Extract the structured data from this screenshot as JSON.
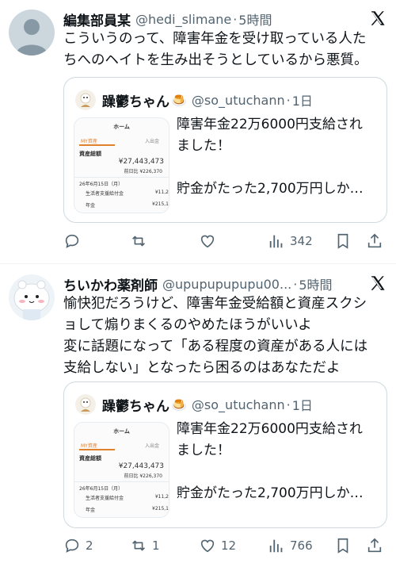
{
  "posts": [
    {
      "author_name": "編集部員某",
      "handle": "@hedi_slimane",
      "separator": "·",
      "time": "5時間",
      "lines": [
        "こういうのって、障害年金を受け取っている人た",
        "ちへのヘイトを生み出そうとしているから悪質。"
      ],
      "quote": {
        "name": "躁鬱ちゃん",
        "emoji": "🍮",
        "handle": "@so_utuchann",
        "separator": "·",
        "time": "1日",
        "lines": [
          "障害年金22万6000円支給され",
          "ました！",
          "",
          "貯金がたった2,700万円しか…"
        ],
        "thumb": {
          "tab_home": "ホーム",
          "tab_left": "MY資産",
          "tab_right": "入出金",
          "label": "資産総額",
          "total": "¥27,443,473",
          "diff": "前日比 ¥226,370",
          "date": "26年6月15日（月）",
          "row1": "生活者支援給付金",
          "row1_value": "¥11,2",
          "row2": "年金",
          "row2_value": "¥215,1"
        }
      },
      "actions": {
        "replies": "",
        "reposts": "",
        "likes": "",
        "views": "342"
      }
    },
    {
      "author_name": "ちいかわ薬剤師",
      "handle": "@upupupupupu00...",
      "separator": "·",
      "time": "5時間",
      "lines": [
        "愉快犯だろうけど、障害年金受給額と資産スクシ",
        "ョして煽りまくるのやめたほうがいいよ",
        "変に話題になって「ある程度の資産がある人には",
        "支給しない」となったら困るのはあなただよ"
      ],
      "quote": {
        "name": "躁鬱ちゃん",
        "emoji": "🍮",
        "handle": "@so_utuchann",
        "separator": "·",
        "time": "1日",
        "lines": [
          "障害年金22万6000円支給され",
          "ました！",
          "",
          "貯金がたった2,700万円しか…"
        ],
        "thumb": {
          "tab_home": "ホーム",
          "tab_left": "MY資産",
          "tab_right": "入出金",
          "label": "資産総額",
          "total": "¥27,443,473",
          "diff": "前日比 ¥226,370",
          "date": "26年6月15日（月）",
          "row1": "生活者支援給付金",
          "row1_value": "¥11,2",
          "row2": "年金",
          "row2_value": "¥215,1"
        }
      },
      "actions": {
        "replies": "2",
        "reposts": "1",
        "likes": "12",
        "views": "766"
      }
    }
  ],
  "colors": {
    "text": "#0f1419",
    "secondary": "#536471",
    "border": "#cfd9de",
    "divider": "#eff3f4"
  }
}
